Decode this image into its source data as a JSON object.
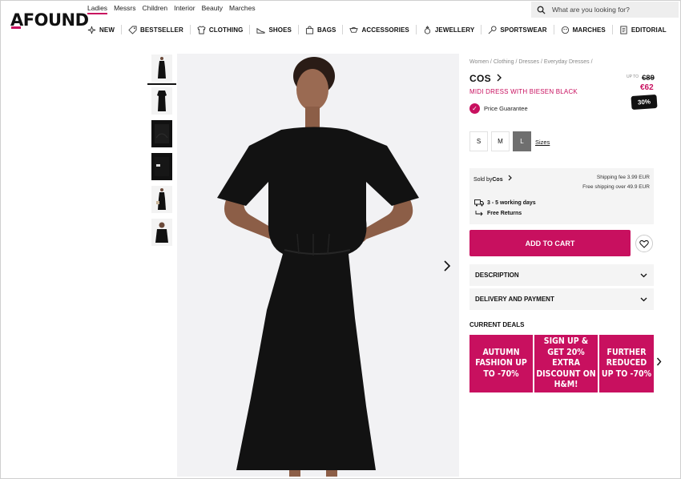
{
  "header": {
    "logo": "AFOUND",
    "top_nav": [
      "Ladies",
      "Messrs",
      "Children",
      "Interior",
      "Beauty",
      "Marches"
    ],
    "active_top": "Ladies",
    "search_placeholder": "What are you looking for?",
    "categories": [
      {
        "label": "NEW",
        "icon": "sparkle-icon"
      },
      {
        "label": "BESTSELLER",
        "icon": "tag-icon"
      },
      {
        "label": "CLOTHING",
        "icon": "shirt-icon"
      },
      {
        "label": "SHOES",
        "icon": "shoe-icon"
      },
      {
        "label": "BAGS",
        "icon": "bag-icon"
      },
      {
        "label": "ACCESSORIES",
        "icon": "accessories-icon"
      },
      {
        "label": "JEWELLERY",
        "icon": "ring-icon"
      },
      {
        "label": "SPORTSWEAR",
        "icon": "sport-icon"
      },
      {
        "label": "MARCHES",
        "icon": "marches-icon"
      },
      {
        "label": "EDITORIAL",
        "icon": "editorial-icon"
      }
    ]
  },
  "product": {
    "breadcrumb": "Women / Clothing / Dresses / Everyday Dresses /",
    "brand": "COS",
    "name": "MIDI DRESS WITH BIESEN BLACK",
    "up_to": "UP TO",
    "price_old": "€89",
    "price_new": "€62",
    "discount": "30%",
    "guarantee": "Price Guarantee",
    "sizes": [
      "S",
      "M",
      "L"
    ],
    "selected_size": "L",
    "sizes_link": "Sizes"
  },
  "seller": {
    "sold_by_label": "Sold by",
    "sold_by": "Cos",
    "shipping_fee": "Shipping fee 3.99 EUR",
    "free_shipping": "Free shipping over 49.9 EUR",
    "delivery": "3 - 5 working days",
    "returns": "Free Returns"
  },
  "actions": {
    "add_to_cart": "ADD TO CART"
  },
  "accordion": [
    "DESCRIPTION",
    "DELIVERY AND PAYMENT"
  ],
  "deals": {
    "title": "CURRENT DEALS",
    "items": [
      "AUTUMN FASHION UP TO -70%",
      "SIGN UP & GET 20% EXTRA DISCOUNT ON H&M!",
      "FURTHER REDUCED UP TO -70%"
    ]
  },
  "colors": {
    "accent": "#c8105f",
    "panel": "#f4f4f4"
  }
}
